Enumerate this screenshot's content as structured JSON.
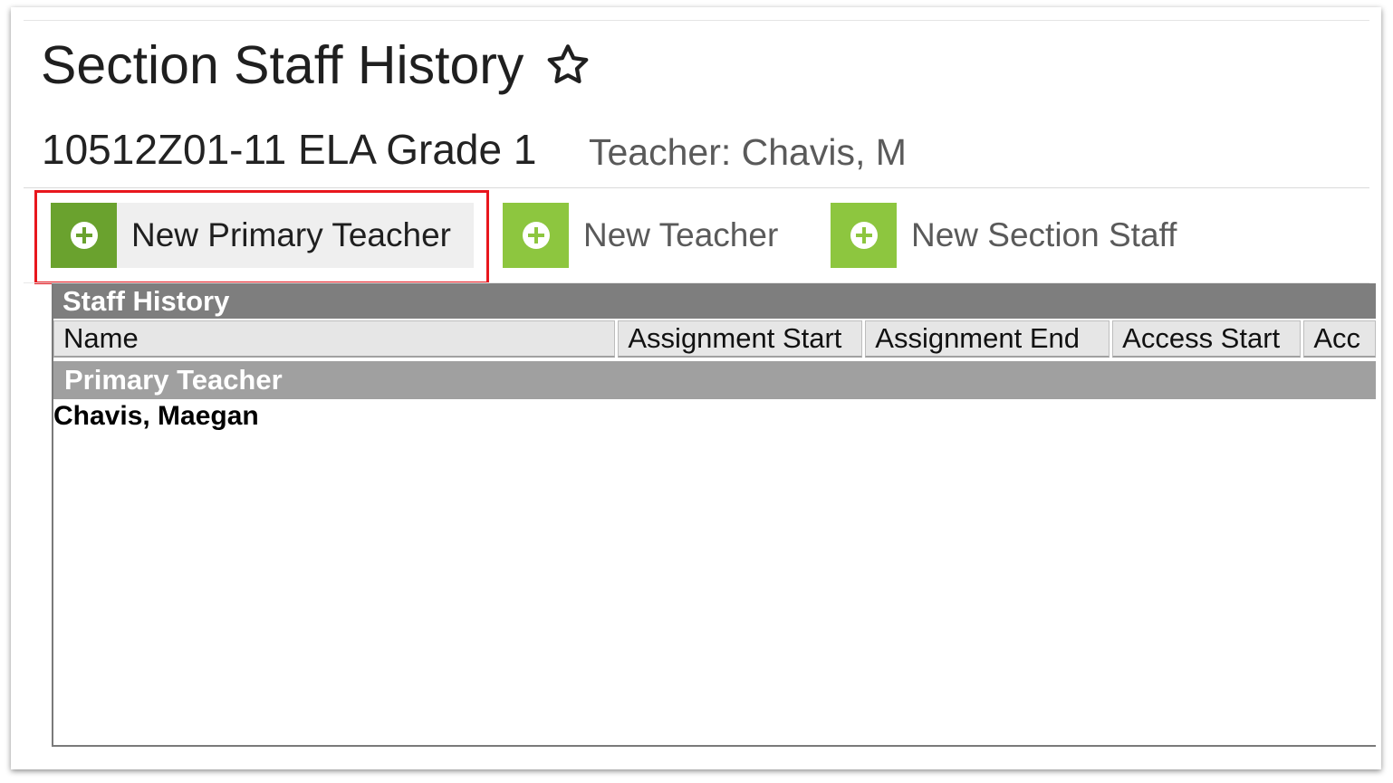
{
  "page": {
    "title": "Section Staff History",
    "favorite_icon": "star-outline-icon"
  },
  "section": {
    "name": "10512Z01-11 ELA Grade 1",
    "teacher": "Teacher: Chavis, M"
  },
  "toolbar": {
    "buttons": [
      {
        "label": "New Primary Teacher",
        "icon": "plus-circle-icon",
        "highlighted": true
      },
      {
        "label": "New Teacher",
        "icon": "plus-circle-icon"
      },
      {
        "label": "New Section Staff",
        "icon": "plus-circle-icon"
      }
    ]
  },
  "table": {
    "caption": "Staff History",
    "columns": [
      "Name",
      "Assignment Start",
      "Assignment End",
      "Access Start",
      "Acc"
    ],
    "groups": [
      {
        "label": "Primary Teacher",
        "rows": [
          {
            "name": "Chavis, Maegan"
          }
        ]
      }
    ]
  },
  "colors": {
    "accent_green": "#8dc63f",
    "accent_green_dark": "#6aa22e",
    "highlight_red": "#e8161d",
    "caption_gray": "#7e7e7e",
    "group_gray": "#a0a0a0"
  }
}
